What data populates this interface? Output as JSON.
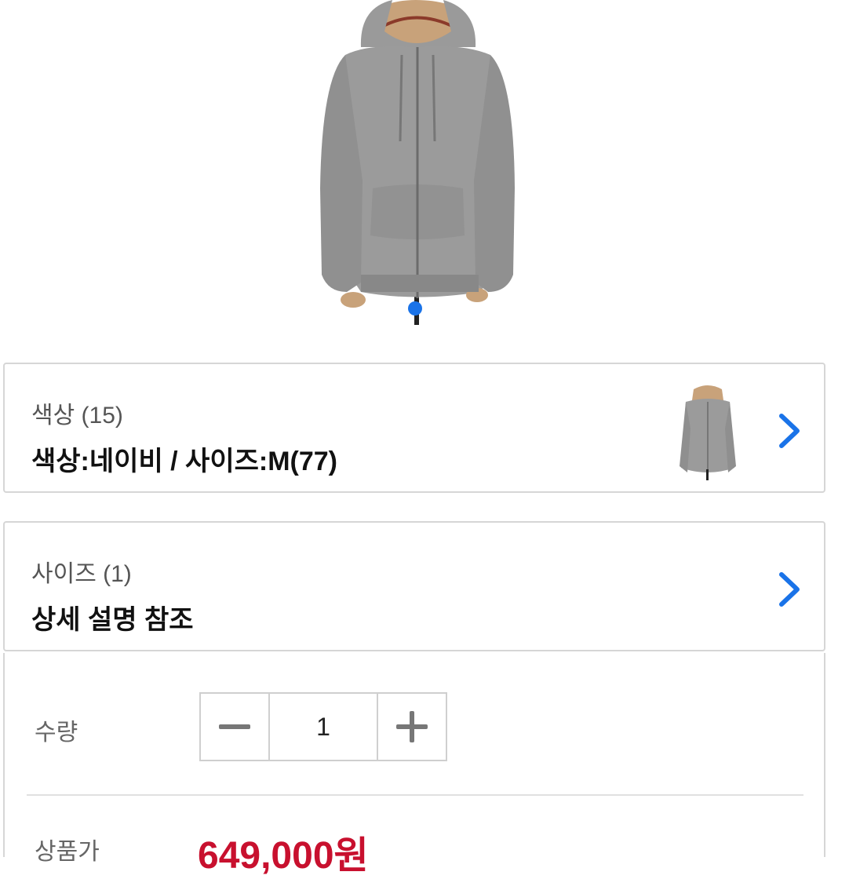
{
  "product": {
    "image": "gray-zip-hoodie-photo",
    "carousel_active": 1
  },
  "options": [
    {
      "label": "색상 (15)",
      "value": "색상:네이비 / 사이즈:M(77)",
      "icon": "chevron-right-icon",
      "has_thumb": true
    },
    {
      "label": "사이즈 (1)",
      "value": "상세 설명 참조",
      "icon": "chevron-right-icon",
      "has_thumb": false
    }
  ],
  "quantity": {
    "label": "수량",
    "value": "1",
    "minus_icon": "minus-icon",
    "plus_icon": "plus-icon"
  },
  "price": {
    "label": "상품가",
    "value": "649,000원"
  },
  "colors": {
    "accent": "#1a73e8",
    "price": "#c8102e",
    "border": "#d6d6d6"
  }
}
